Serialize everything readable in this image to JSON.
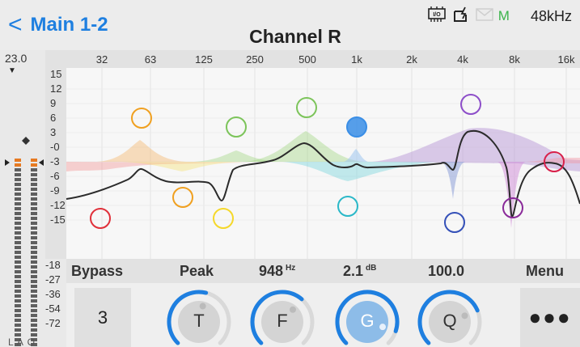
{
  "header": {
    "back_chevron": "<",
    "back_label": "Main 1-2",
    "title": "Channel R",
    "status_icons": [
      "io-chip-icon",
      "battery-icon",
      "mail-icon"
    ],
    "status_m": "M",
    "sample_rate": "48kHz"
  },
  "meter": {
    "gain_readout": "23.0",
    "db_labels": [
      "-18",
      "-27",
      "-36",
      "-54",
      "-72"
    ],
    "channel_labels": "L A O"
  },
  "eq": {
    "freq_labels": [
      "32",
      "63",
      "125",
      "250",
      "500",
      "1k",
      "2k",
      "4k",
      "8k",
      "16k"
    ],
    "db_labels": [
      "15",
      "12",
      "9",
      "6",
      "3",
      "-0",
      "-3",
      "-6",
      "-9",
      "-12",
      "-15"
    ],
    "band_colors": {
      "red": "#e0303a",
      "orange": "#f0a020",
      "yellow": "#f5d82a",
      "green": "#7cc45a",
      "blue": "#3a8ee6",
      "cyan": "#2ab8c8",
      "navy": "#3450b8",
      "purple": "#8d4ec9",
      "magenta": "#8a2a9a",
      "crimson": "#d8204a"
    },
    "selected_band": "blue"
  },
  "params": {
    "bypass": "Bypass",
    "filter_type": "Peak",
    "freq_value": "948",
    "freq_unit": "Hz",
    "gain_value": "2.1",
    "gain_unit": "dB",
    "q_value": "100.0",
    "menu": "Menu"
  },
  "controls": {
    "band_number": "3",
    "knobs": [
      {
        "label": "T",
        "level": 0.55
      },
      {
        "label": "F",
        "level": 0.65
      },
      {
        "label": "G",
        "level": 0.9
      },
      {
        "label": "Q",
        "level": 0.75
      }
    ],
    "more": "●●●",
    "accent": "#1e7fe0"
  }
}
